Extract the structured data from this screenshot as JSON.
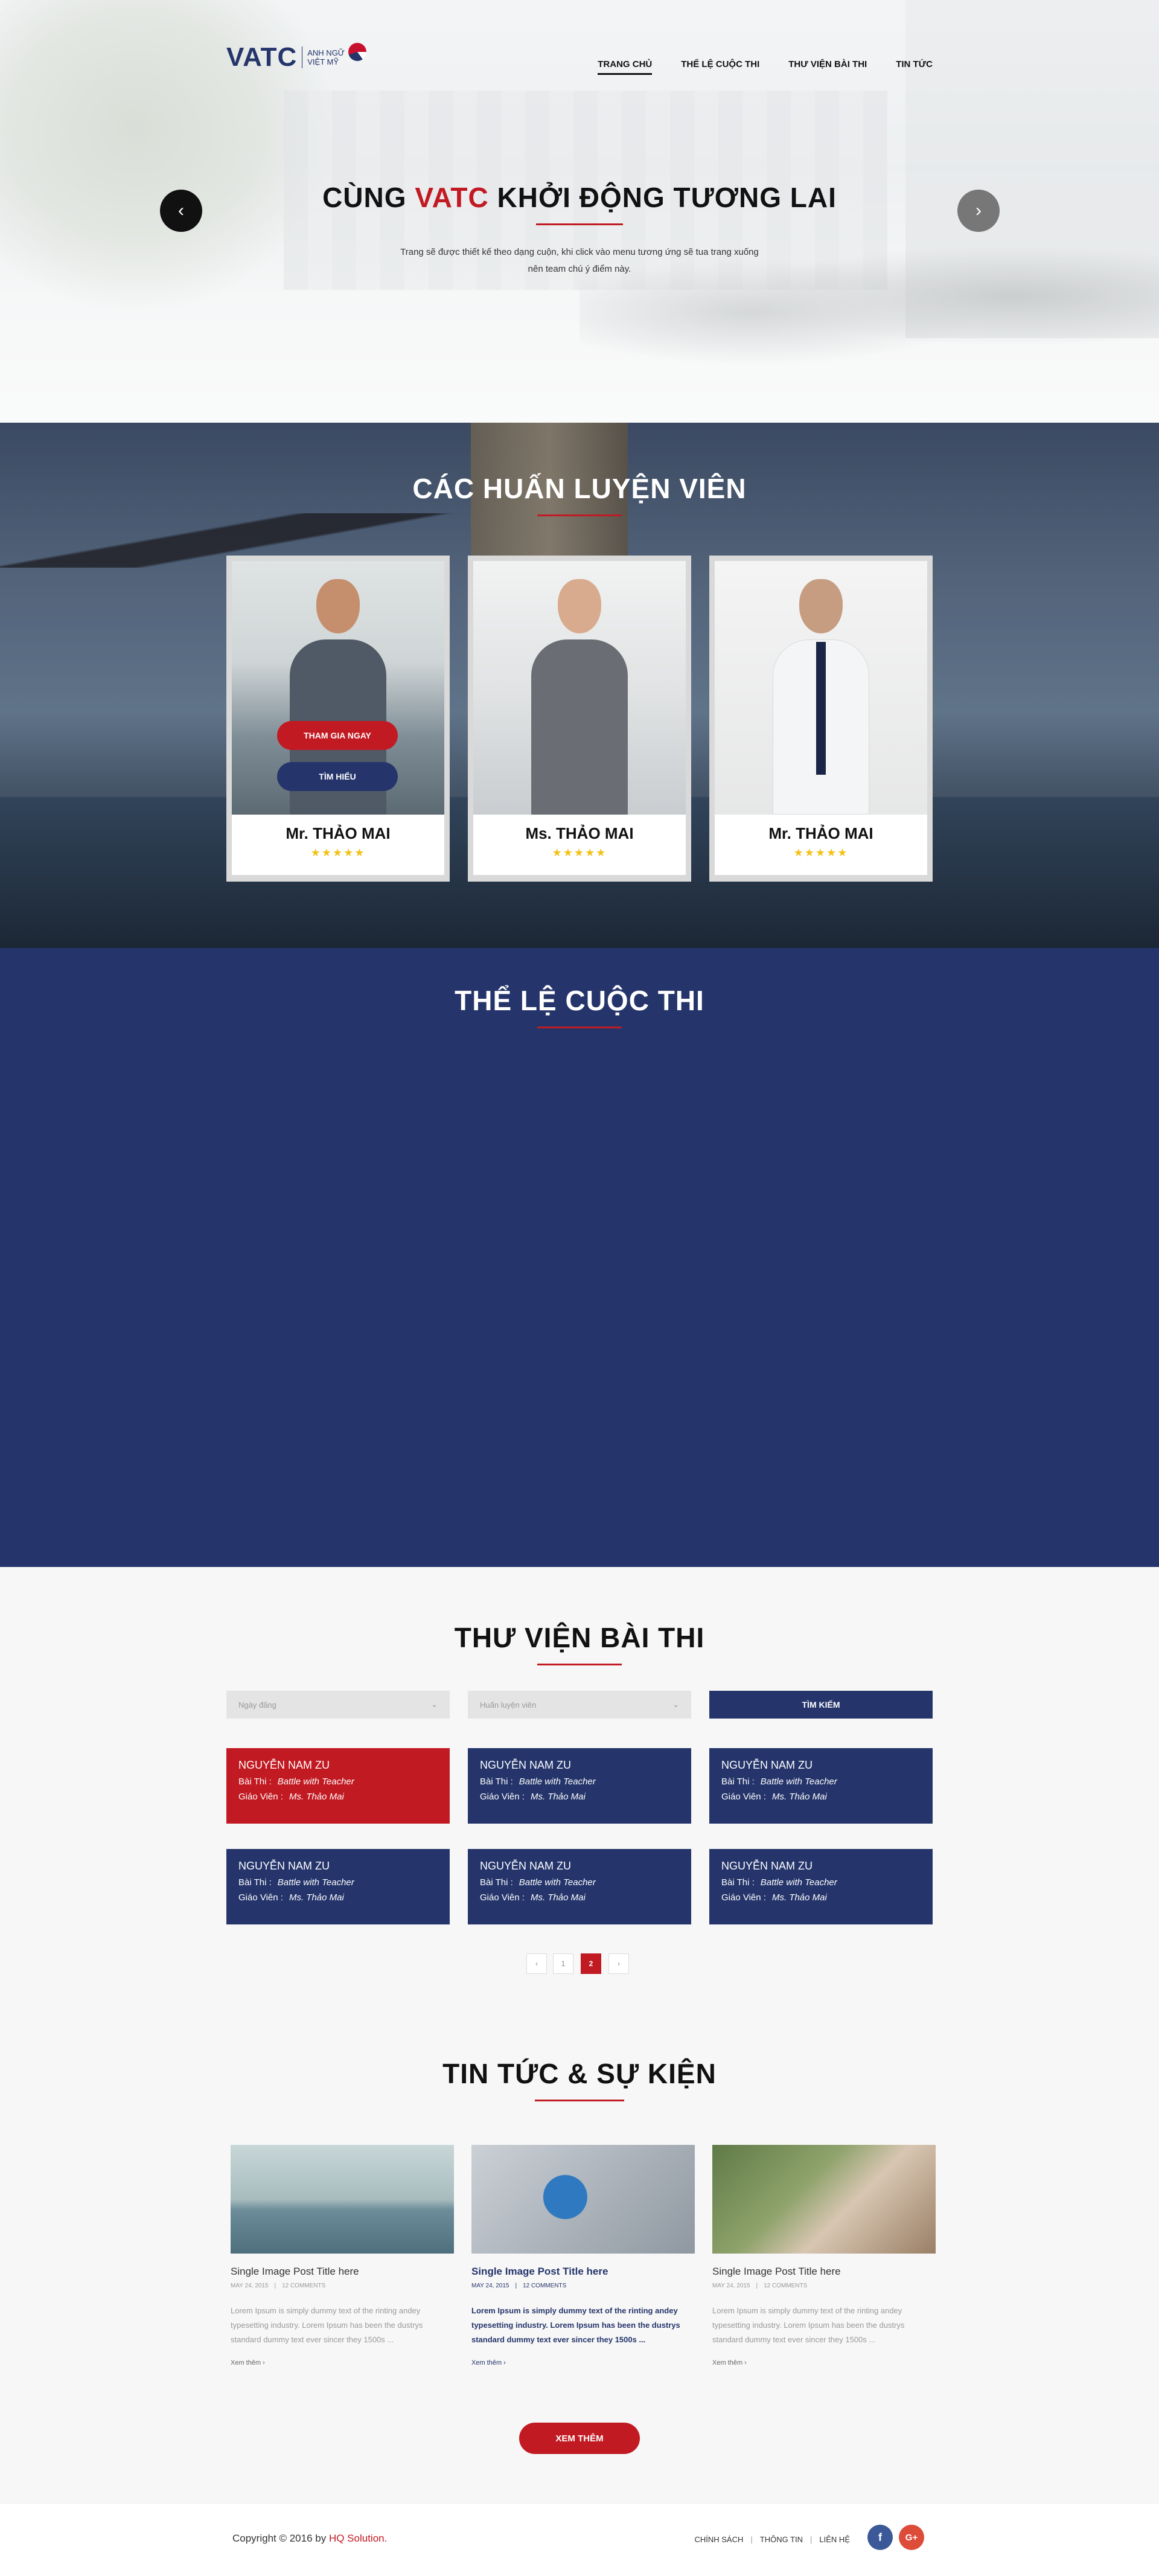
{
  "header": {
    "logo_text": "VATC",
    "logo_sub_line1": "ANH NGỮ",
    "logo_sub_line2": "VIỆT MỸ",
    "nav": [
      {
        "label": "TRANG CHỦ",
        "active": true
      },
      {
        "label": "THỂ LỆ CUỘC THI",
        "active": false
      },
      {
        "label": "THƯ VIỆN BÀI THI",
        "active": false
      },
      {
        "label": "TIN TỨC",
        "active": false
      }
    ]
  },
  "hero": {
    "title_before": "CÙNG ",
    "title_highlight": "VATC",
    "title_after": " KHỞI ĐỘNG TƯƠNG LAI",
    "desc_line1": "Trang sẽ được thiết kế theo dạng cuộn, khi click vào menu tương ứng sẽ tua trang xuống",
    "desc_line2": "nên team chú ý điểm này.",
    "prev_icon": "‹",
    "next_icon": "›"
  },
  "trainers": {
    "title": "CÁC HUẤN LUYỆN VIÊN",
    "join_label": "THAM GIA NGAY",
    "learn_label": "TÌM HIỂU",
    "items": [
      {
        "name": "Mr. THẢO MAI",
        "stars": "★★★★★"
      },
      {
        "name": "Ms. THẢO MAI",
        "stars": "★★★★★"
      },
      {
        "name": "Mr. THẢO MAI",
        "stars": "★★★★★"
      }
    ]
  },
  "rules": {
    "title": "THỂ LỆ CUỘC THI"
  },
  "library": {
    "title": "THƯ VIỆN BÀI THI",
    "filter_date": "Ngày đăng",
    "filter_trainer": "Huấn luyện viên",
    "search_label": "TÌM KIẾM",
    "label_exam": "Bài Thi :",
    "label_teacher": "Giáo Viên :",
    "entries": [
      {
        "name": "NGUYỄN NAM ZU",
        "exam": "Battle with Teacher",
        "teacher": "Ms. Thảo Mai"
      },
      {
        "name": "NGUYỄN NAM ZU",
        "exam": "Battle with Teacher",
        "teacher": "Ms. Thảo Mai"
      },
      {
        "name": "NGUYỄN NAM ZU",
        "exam": "Battle with Teacher",
        "teacher": "Ms. Thảo Mai"
      },
      {
        "name": "NGUYỄN NAM ZU",
        "exam": "Battle with Teacher",
        "teacher": "Ms. Thảo Mai"
      },
      {
        "name": "NGUYỄN NAM ZU",
        "exam": "Battle with Teacher",
        "teacher": "Ms. Thảo Mai"
      },
      {
        "name": "NGUYỄN NAM ZU",
        "exam": "Battle with Teacher",
        "teacher": "Ms. Thảo Mai"
      }
    ],
    "pagination": [
      "‹",
      "1",
      "2",
      "›"
    ]
  },
  "news": {
    "title": "TIN TỨC & SỰ KIỆN",
    "posts": [
      {
        "title": "Single Image Post Title here",
        "date": "MAY 24, 2015",
        "comments": "12 COMMENTS",
        "excerpt": "Lorem Ipsum is simply dummy text of the rinting andey typesetting industry. Lorem Ipsum has been the dustrys standard dummy text ever sincer they 1500s ...",
        "more": "Xem thêm ›"
      },
      {
        "title": "Single Image Post Title here",
        "date": "MAY 24, 2015",
        "comments": "12 COMMENTS",
        "excerpt": "Lorem Ipsum is simply dummy text of the rinting andey typesetting industry. Lorem Ipsum has been the dustrys standard dummy text ever sincer they 1500s ...",
        "more": "Xem thêm ›"
      },
      {
        "title": "Single Image Post Title here",
        "date": "MAY 24, 2015",
        "comments": "12 COMMENTS",
        "excerpt": "Lorem Ipsum is simply dummy text of the rinting andey typesetting industry. Lorem Ipsum has been the dustrys standard dummy text ever sincer they 1500s ...",
        "more": "Xem thêm ›"
      }
    ],
    "more_label": "XEM THÊM"
  },
  "footer": {
    "copy_prefix": "Copyright © 2016 by ",
    "copy_brand": "HQ Solution.",
    "links": [
      "CHÍNH SÁCH",
      "THÔNG TIN",
      "LIÊN HỆ"
    ],
    "facebook": "f",
    "google": "G+"
  },
  "colors": {
    "brand_blue": "#25356b",
    "brand_red": "#c21a22",
    "star": "#f2c217"
  }
}
